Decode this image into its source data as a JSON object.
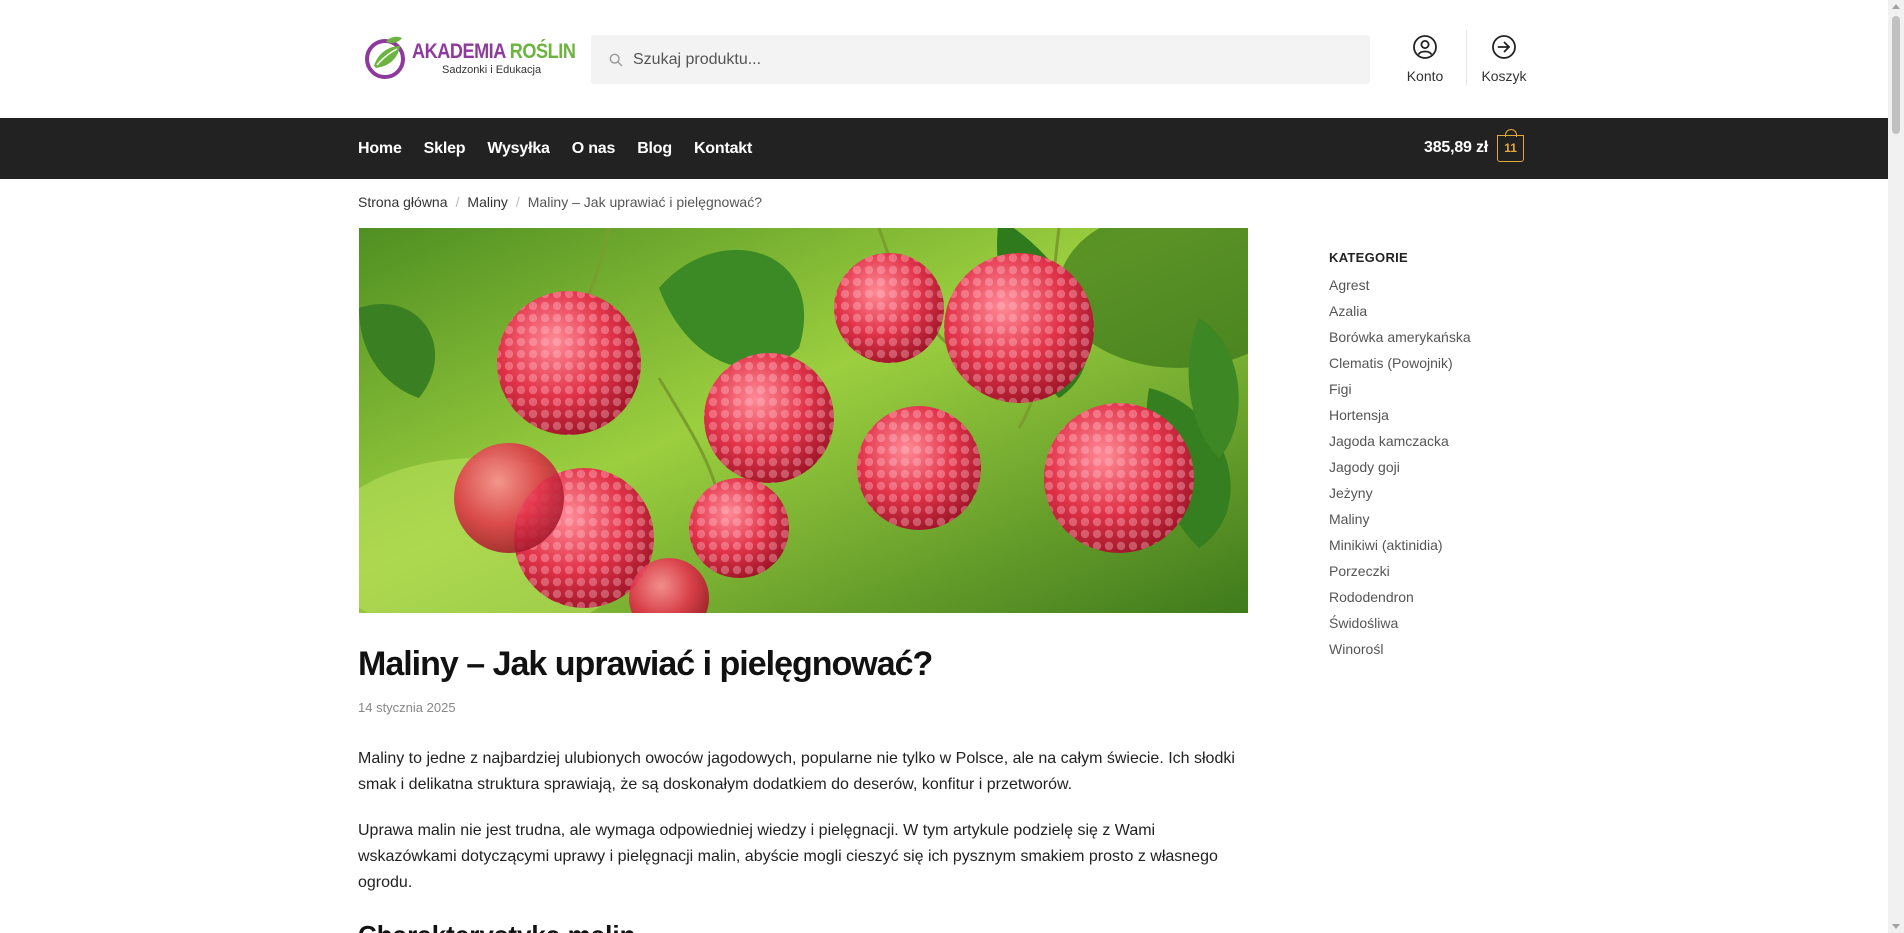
{
  "logo": {
    "title_a": "AKADEMIA ",
    "title_b": "ROŚLIN",
    "subtitle": "Sadzonki i Edukacja"
  },
  "search": {
    "placeholder": "Szukaj produktu..."
  },
  "header": {
    "account_label": "Konto",
    "cart_label": "Koszyk"
  },
  "nav": {
    "items": [
      "Home",
      "Sklep",
      "Wysyłka",
      "O nas",
      "Blog",
      "Kontakt"
    ]
  },
  "cart": {
    "total": "385,89 zł",
    "count": "11"
  },
  "breadcrumb": {
    "home": "Strona główna",
    "category": "Maliny",
    "current": "Maliny – Jak uprawiać i pielęgnować?",
    "separator": "/"
  },
  "article": {
    "title": "Maliny – Jak uprawiać i pielęgnować?",
    "date": "14 stycznia 2025",
    "paragraphs": [
      "Maliny to jedne z najbardziej ulubionych owoców jagodowych, popularne nie tylko w Polsce, ale na całym świecie. Ich słodki smak i delikatna struktura sprawiają, że są doskonałym dodatkiem do deserów, konfitur i przetworów.",
      "Uprawa malin nie jest trudna, ale wymaga odpowiedniej wiedzy i pielęgnacji. W tym artykule podzielę się z Wami wskazówkami dotyczącymi uprawy i pielęgnacji malin, abyście mogli cieszyć się ich pysznym smakiem prosto z własnego ogrodu."
    ],
    "next_heading": "Charakterystyka malin"
  },
  "sidebar": {
    "title": "KATEGORIE",
    "categories": [
      "Agrest",
      "Azalia",
      "Borówka amerykańska",
      "Clematis (Powojnik)",
      "Figi",
      "Hortensja",
      "Jagoda kamczacka",
      "Jagody goji",
      "Jeżyny",
      "Maliny",
      "Minikiwi (aktinidia)",
      "Porzeczki",
      "Rododendron",
      "Świdośliwa",
      "Winorośl"
    ]
  },
  "colors": {
    "brand_purple": "#8e3a9c",
    "brand_green": "#6cb33f",
    "navbar": "#222222",
    "cart_accent": "#e2a83a"
  },
  "icons": {
    "search": "search-icon",
    "account": "user-circle-icon",
    "cart": "arrow-circle-right-icon",
    "bag": "shopping-bag-icon"
  }
}
